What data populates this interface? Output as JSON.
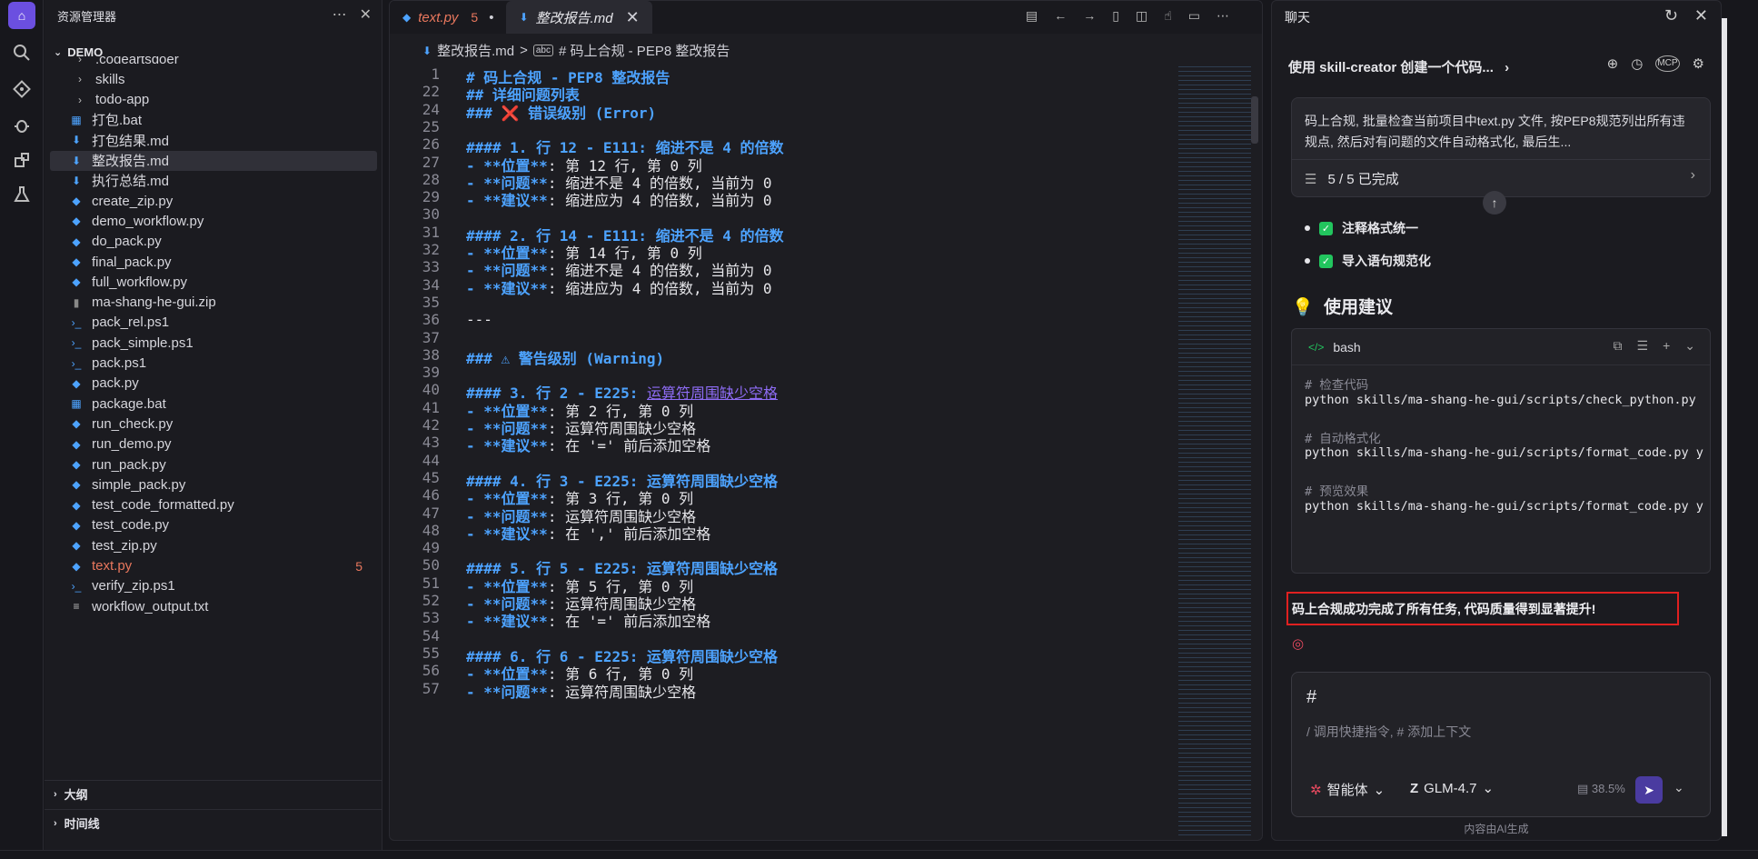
{
  "explorer": {
    "title": "资源管理器",
    "root": "DEMO",
    "files": [
      {
        "name": ".codeartsdoer",
        "icon": "chevron",
        "kind": "folder"
      },
      {
        "name": "skills",
        "icon": "chevron",
        "kind": "folder"
      },
      {
        "name": "todo-app",
        "icon": "chevron",
        "kind": "folder"
      },
      {
        "name": "打包.bat",
        "icon": "windows",
        "kind": "file"
      },
      {
        "name": "打包结果.md",
        "icon": "markdown",
        "kind": "file"
      },
      {
        "name": "整改报告.md",
        "icon": "markdown",
        "kind": "file",
        "selected": true
      },
      {
        "name": "执行总结.md",
        "icon": "markdown",
        "kind": "file"
      },
      {
        "name": "create_zip.py",
        "icon": "python",
        "kind": "file"
      },
      {
        "name": "demo_workflow.py",
        "icon": "python",
        "kind": "file"
      },
      {
        "name": "do_pack.py",
        "icon": "python",
        "kind": "file"
      },
      {
        "name": "final_pack.py",
        "icon": "python",
        "kind": "file"
      },
      {
        "name": "full_workflow.py",
        "icon": "python",
        "kind": "file"
      },
      {
        "name": "ma-shang-he-gui.zip",
        "icon": "zip",
        "kind": "file"
      },
      {
        "name": "pack_rel.ps1",
        "icon": "powershell",
        "kind": "file"
      },
      {
        "name": "pack_simple.ps1",
        "icon": "powershell",
        "kind": "file"
      },
      {
        "name": "pack.ps1",
        "icon": "powershell",
        "kind": "file"
      },
      {
        "name": "pack.py",
        "icon": "python",
        "kind": "file"
      },
      {
        "name": "package.bat",
        "icon": "windows",
        "kind": "file"
      },
      {
        "name": "run_check.py",
        "icon": "python",
        "kind": "file"
      },
      {
        "name": "run_demo.py",
        "icon": "python",
        "kind": "file"
      },
      {
        "name": "run_pack.py",
        "icon": "python",
        "kind": "file"
      },
      {
        "name": "simple_pack.py",
        "icon": "python",
        "kind": "file"
      },
      {
        "name": "test_code_formatted.py",
        "icon": "python",
        "kind": "file"
      },
      {
        "name": "test_code.py",
        "icon": "python",
        "kind": "file"
      },
      {
        "name": "test_zip.py",
        "icon": "python",
        "kind": "file"
      },
      {
        "name": "text.py",
        "icon": "python",
        "kind": "file",
        "error": true,
        "badge": "5"
      },
      {
        "name": "verify_zip.ps1",
        "icon": "powershell",
        "kind": "file"
      },
      {
        "name": "workflow_output.txt",
        "icon": "text",
        "kind": "file"
      }
    ],
    "outline": "大纲",
    "timeline": "时间线"
  },
  "editor": {
    "tabs": [
      {
        "label": "text.py",
        "count": "5",
        "dirty": "•"
      },
      {
        "label": "整改报告.md",
        "close": "✕"
      }
    ],
    "breadcrumb": {
      "file": "整改报告.md",
      "sep": ">",
      "heading": "# 码上合规 - PEP8 整改报告"
    },
    "lines": [
      {
        "n": "1",
        "segs": [
          {
            "c": "h",
            "t": "# 码上合规 - PEP8 整改报告"
          }
        ]
      },
      {
        "n": "22",
        "segs": [
          {
            "c": "h",
            "t": "## 详细问题列表"
          }
        ]
      },
      {
        "n": "24",
        "segs": [
          {
            "c": "h",
            "t": "### ❌ 错误级别 (Error)"
          }
        ]
      },
      {
        "n": "25",
        "segs": []
      },
      {
        "n": "26",
        "segs": [
          {
            "c": "h",
            "t": "#### 1. 行 12 - E111: 缩进不是 4 的倍数"
          }
        ]
      },
      {
        "n": "27",
        "segs": [
          {
            "c": "b",
            "t": "- **位置**"
          },
          {
            "c": "t",
            "t": ": 第 12 行, 第 0 列"
          }
        ]
      },
      {
        "n": "28",
        "segs": [
          {
            "c": "b",
            "t": "- **问题**"
          },
          {
            "c": "t",
            "t": ": 缩进不是 4 的倍数, 当前为 0"
          }
        ]
      },
      {
        "n": "29",
        "segs": [
          {
            "c": "b",
            "t": "- **建议**"
          },
          {
            "c": "t",
            "t": ": 缩进应为 4 的倍数, 当前为 0"
          }
        ]
      },
      {
        "n": "30",
        "segs": []
      },
      {
        "n": "31",
        "segs": [
          {
            "c": "h",
            "t": "#### 2. 行 14 - E111: 缩进不是 4 的倍数"
          }
        ]
      },
      {
        "n": "32",
        "segs": [
          {
            "c": "b",
            "t": "- **位置**"
          },
          {
            "c": "t",
            "t": ": 第 14 行, 第 0 列"
          }
        ]
      },
      {
        "n": "33",
        "segs": [
          {
            "c": "b",
            "t": "- **问题**"
          },
          {
            "c": "t",
            "t": ": 缩进不是 4 的倍数, 当前为 0"
          }
        ]
      },
      {
        "n": "34",
        "segs": [
          {
            "c": "b",
            "t": "- **建议**"
          },
          {
            "c": "t",
            "t": ": 缩进应为 4 的倍数, 当前为 0"
          }
        ]
      },
      {
        "n": "35",
        "segs": []
      },
      {
        "n": "36",
        "segs": [
          {
            "c": "t",
            "t": "---"
          }
        ]
      },
      {
        "n": "37",
        "segs": []
      },
      {
        "n": "38",
        "segs": [
          {
            "c": "h",
            "t": "### ⚠ 警告级别 (Warning)"
          }
        ]
      },
      {
        "n": "39",
        "segs": []
      },
      {
        "n": "40",
        "segs": [
          {
            "c": "h",
            "t": "#### 3. 行 2 - E225: "
          },
          {
            "c": "lk",
            "t": "运算符周围缺少空格"
          }
        ]
      },
      {
        "n": "41",
        "segs": [
          {
            "c": "b",
            "t": "- **位置**"
          },
          {
            "c": "t",
            "t": ": 第 2 行, 第 0 列"
          }
        ]
      },
      {
        "n": "42",
        "segs": [
          {
            "c": "b",
            "t": "- **问题**"
          },
          {
            "c": "t",
            "t": ": 运算符周围缺少空格"
          }
        ]
      },
      {
        "n": "43",
        "segs": [
          {
            "c": "b",
            "t": "- **建议**"
          },
          {
            "c": "t",
            "t": ": 在 '=' 前后添加空格"
          }
        ]
      },
      {
        "n": "44",
        "segs": []
      },
      {
        "n": "45",
        "segs": [
          {
            "c": "h",
            "t": "#### 4. 行 3 - E225: 运算符周围缺少空格"
          }
        ]
      },
      {
        "n": "46",
        "segs": [
          {
            "c": "b",
            "t": "- **位置**"
          },
          {
            "c": "t",
            "t": ": 第 3 行, 第 0 列"
          }
        ]
      },
      {
        "n": "47",
        "segs": [
          {
            "c": "b",
            "t": "- **问题**"
          },
          {
            "c": "t",
            "t": ": 运算符周围缺少空格"
          }
        ]
      },
      {
        "n": "48",
        "segs": [
          {
            "c": "b",
            "t": "- **建议**"
          },
          {
            "c": "t",
            "t": ": 在 ',' 前后添加空格"
          }
        ]
      },
      {
        "n": "49",
        "segs": []
      },
      {
        "n": "50",
        "segs": [
          {
            "c": "h",
            "t": "#### 5. 行 5 - E225: 运算符周围缺少空格"
          }
        ]
      },
      {
        "n": "51",
        "segs": [
          {
            "c": "b",
            "t": "- **位置**"
          },
          {
            "c": "t",
            "t": ": 第 5 行, 第 0 列"
          }
        ]
      },
      {
        "n": "52",
        "segs": [
          {
            "c": "b",
            "t": "- **问题**"
          },
          {
            "c": "t",
            "t": ": 运算符周围缺少空格"
          }
        ]
      },
      {
        "n": "53",
        "segs": [
          {
            "c": "b",
            "t": "- **建议**"
          },
          {
            "c": "t",
            "t": ": 在 '=' 前后添加空格"
          }
        ]
      },
      {
        "n": "54",
        "segs": []
      },
      {
        "n": "55",
        "segs": [
          {
            "c": "h",
            "t": "#### 6. 行 6 - E225: 运算符周围缺少空格"
          }
        ]
      },
      {
        "n": "56",
        "segs": [
          {
            "c": "b",
            "t": "- **位置**"
          },
          {
            "c": "t",
            "t": ": 第 6 行, 第 0 列"
          }
        ]
      },
      {
        "n": "57",
        "segs": [
          {
            "c": "b",
            "t": "- **问题**"
          },
          {
            "c": "t",
            "t": ": 运算符周围缺少空格"
          }
        ]
      }
    ]
  },
  "chat": {
    "title": "聊天",
    "conversation": "使用 skill-creator 创建一个代码...",
    "task": {
      "question": "码上合规, 批量检查当前项目中text.py 文件, 按PEP8规范列出所有违规点, 然后对有问题的文件自动格式化, 最后生...",
      "progress": "5 / 5 已完成"
    },
    "checklist": [
      "注释格式统一",
      "导入语句规范化"
    ],
    "section_title": "使用建议",
    "section_icon": "💡",
    "code": {
      "lang": "bash",
      "lines": [
        {
          "k": "cmt",
          "t": "# 检查代码"
        },
        {
          "k": "cmd",
          "t": "python skills/ma-shang-he-gui/scripts/check_python.py"
        },
        {
          "k": "gap",
          "t": ""
        },
        {
          "k": "cmt",
          "t": "# 自动格式化"
        },
        {
          "k": "cmd",
          "t": "python skills/ma-shang-he-gui/scripts/format_code.py y"
        },
        {
          "k": "gap",
          "t": ""
        },
        {
          "k": "cmt",
          "t": "# 预览效果"
        },
        {
          "k": "cmd",
          "t": "python skills/ma-shang-he-gui/scripts/format_code.py y"
        }
      ]
    },
    "summary": "码上合规成功完成了所有任务, 代码质量得到显著提升!",
    "input": {
      "hash": "#",
      "placeholder": "/ 调用快捷指令, # 添加上下文"
    },
    "agent_label": "智能体",
    "model_label": "GLM-4.7",
    "context_pct": "38.5%",
    "footer": "内容由AI生成"
  },
  "colors": {
    "accent": "#6b4fe0",
    "error": "#e8775d",
    "heading": "#4da3ff",
    "success": "#22c55e",
    "highlight_border": "#e02020"
  }
}
